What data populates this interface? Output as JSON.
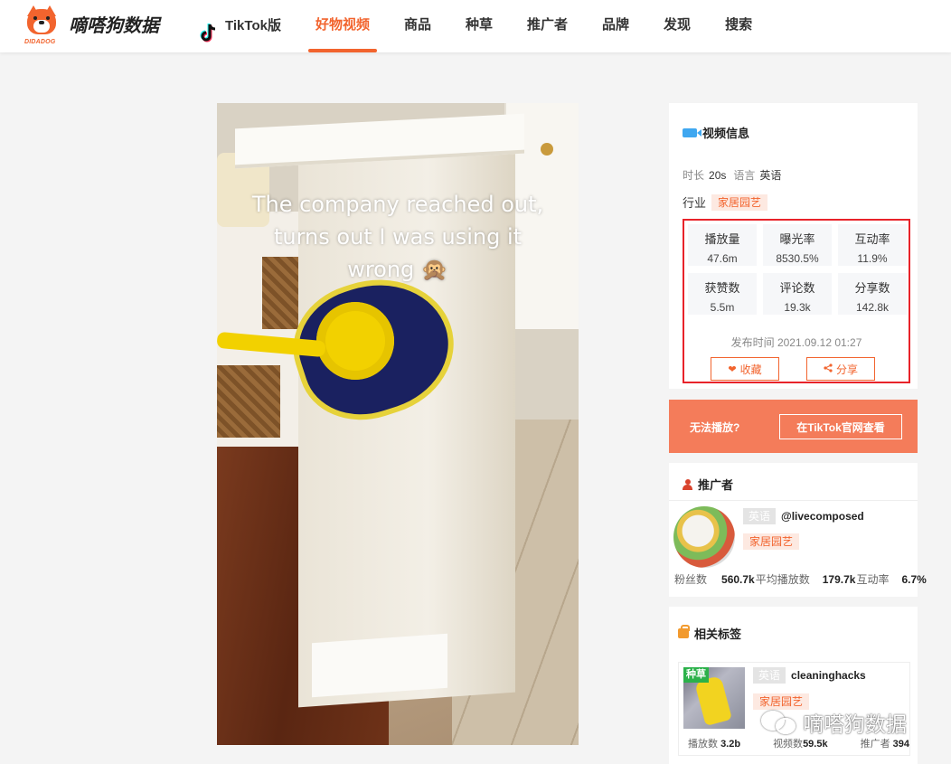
{
  "header": {
    "logo_name": "嘀嗒狗数据",
    "logo_sub": "DIDADOG",
    "nav": [
      {
        "label": "TikTok版"
      },
      {
        "label": "好物视频"
      },
      {
        "label": "商品"
      },
      {
        "label": "种草"
      },
      {
        "label": "推广者"
      },
      {
        "label": "品牌"
      },
      {
        "label": "发现"
      },
      {
        "label": "搜索"
      }
    ],
    "active_nav": "好物视频"
  },
  "video": {
    "caption_lines": [
      "The company reached out,",
      "turns out I was using it",
      "wrong 🙊"
    ]
  },
  "video_info": {
    "title": "视频信息",
    "duration_label": "时长",
    "duration": "20s",
    "language_label": "语言",
    "language": "英语",
    "industry_label": "行业",
    "industry": "家居园艺",
    "stats": [
      {
        "label": "播放量",
        "value": "47.6m"
      },
      {
        "label": "曝光率",
        "value": "8530.5%"
      },
      {
        "label": "互动率",
        "value": "11.9%"
      },
      {
        "label": "获赞数",
        "value": "5.5m"
      },
      {
        "label": "评论数",
        "value": "19.3k"
      },
      {
        "label": "分享数",
        "value": "142.8k"
      }
    ],
    "publish_time": "发布时间 2021.09.12 01:27",
    "favorite_label": "收藏",
    "share_label": "分享"
  },
  "cant_play": {
    "text": "无法播放?",
    "button": "在TikTok官网查看"
  },
  "promoter": {
    "title": "推广者",
    "language": "英语",
    "handle": "@livecomposed",
    "category": "家居园艺",
    "fans_label": "粉丝数",
    "fans": "560.7k",
    "avg_play_label": "平均播放数",
    "avg_play": "179.7k",
    "engagement_label": "互动率",
    "engagement": "6.7%"
  },
  "related_tags": {
    "title": "相关标签",
    "badge": "种草",
    "language": "英语",
    "name": "cleaninghacks",
    "category": "家居园艺",
    "play_label": "播放数",
    "play": "3.2b",
    "video_label": "视频数",
    "videos": "59.5k",
    "promoter_label": "推广者",
    "promoters": "394"
  },
  "watermark": "嘀嗒狗数据",
  "colors": {
    "accent": "#f2642e",
    "highlight_border": "#e8232a",
    "banner": "#f47c5a"
  }
}
